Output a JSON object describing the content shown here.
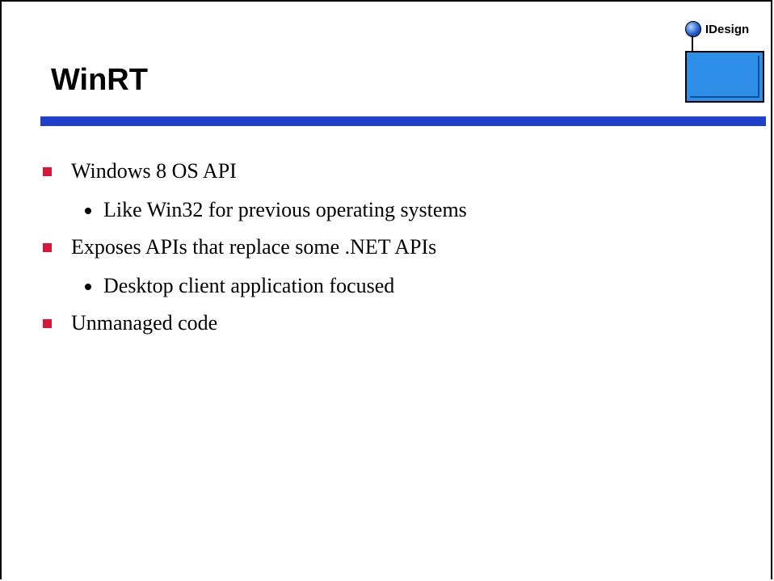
{
  "slide": {
    "title": "WinRT",
    "logo_text": "IDesign",
    "accent_color": "#1f3fc8",
    "bullet_color": "#dc1437",
    "bullets": [
      {
        "level": 1,
        "text": "Windows 8 OS API"
      },
      {
        "level": 2,
        "text": "Like Win32 for previous operating systems"
      },
      {
        "level": 1,
        "text": "Exposes APIs that replace some .NET APIs"
      },
      {
        "level": 2,
        "text": "Desktop client application focused"
      },
      {
        "level": 1,
        "text": "Unmanaged code"
      }
    ]
  }
}
